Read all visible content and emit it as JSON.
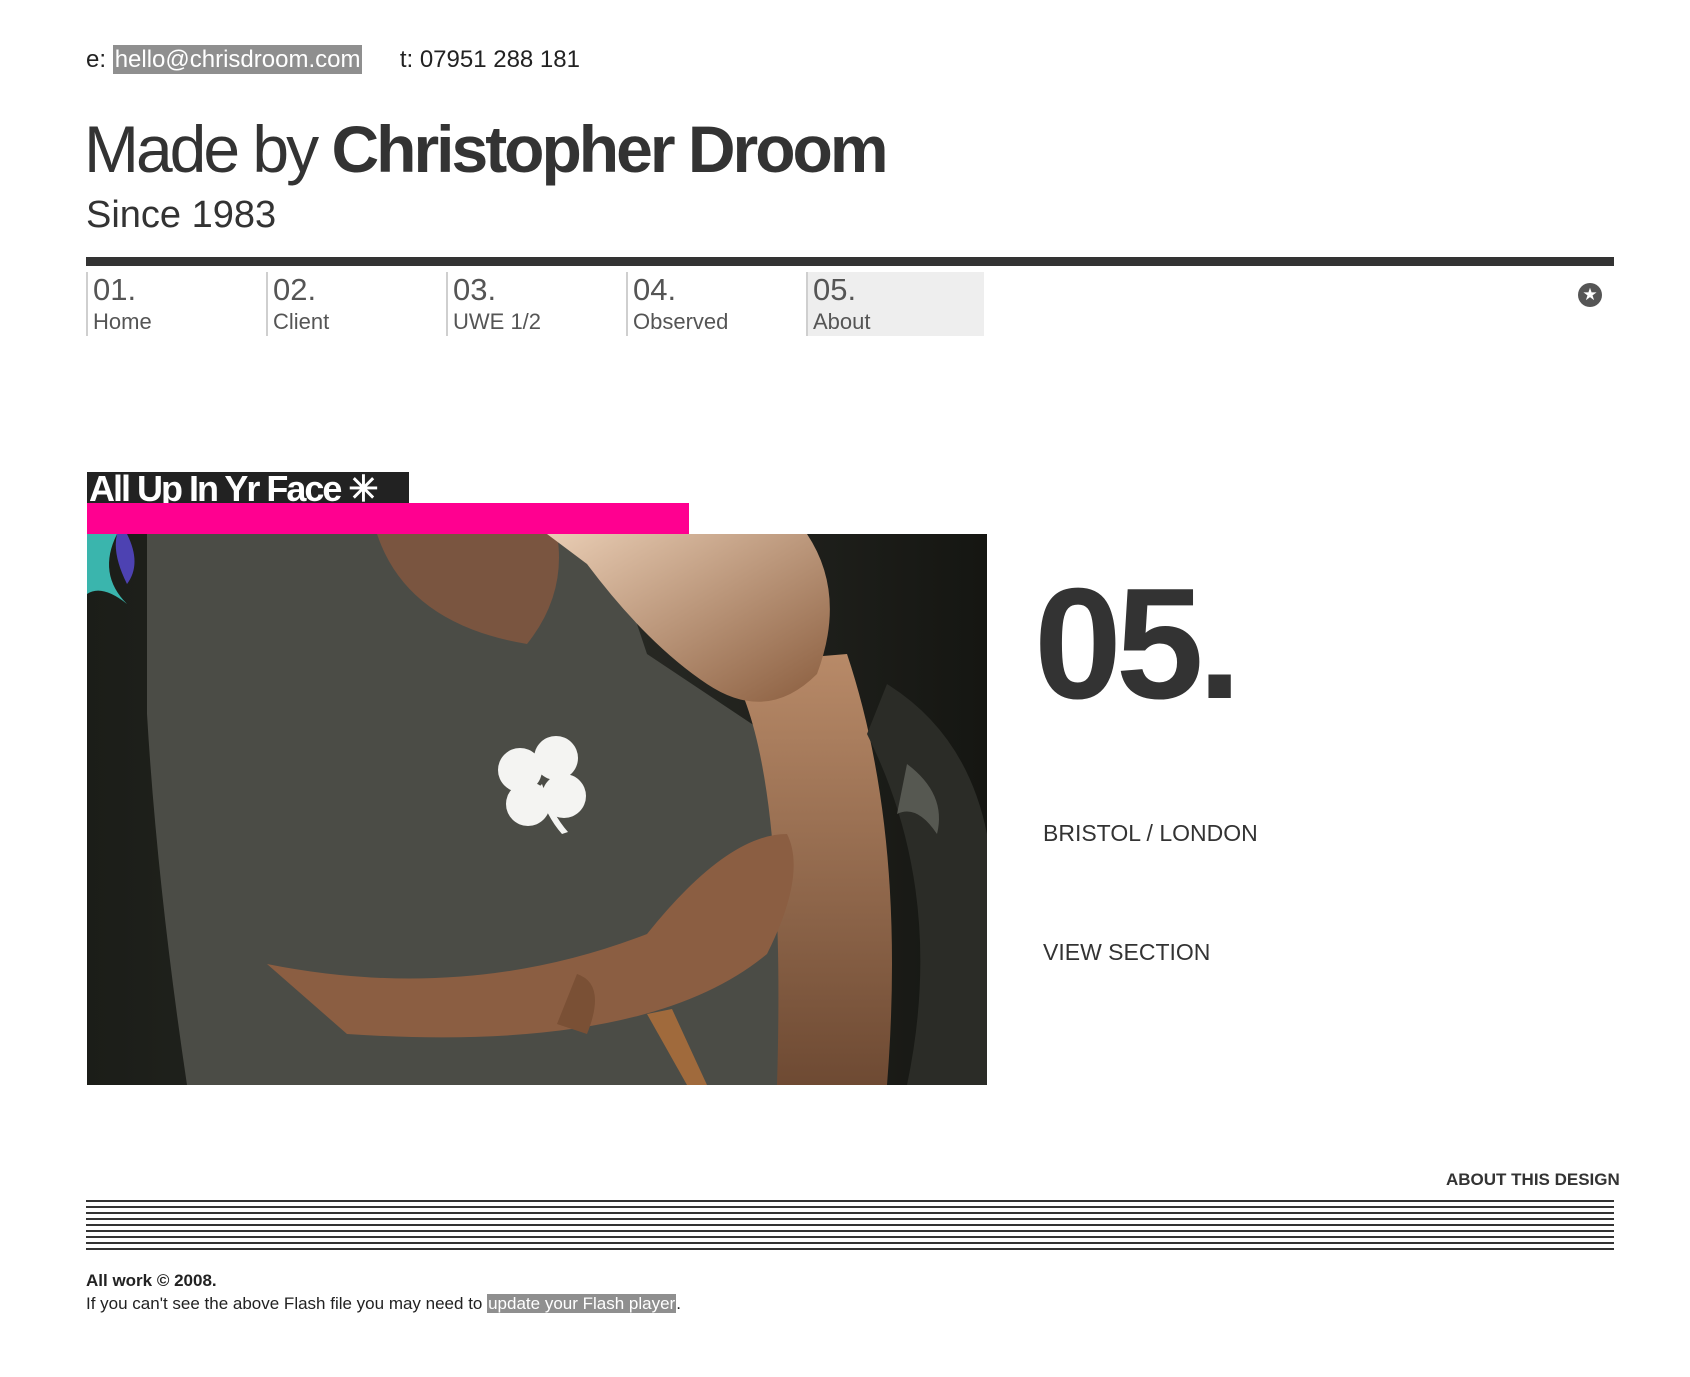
{
  "contact": {
    "email_prefix": "e:",
    "email": "hello@chrisdroom.com",
    "phone": "t: 07951 288 181"
  },
  "header": {
    "title_prefix": "Made by ",
    "title_name": "Christopher Droom",
    "subtitle": "Since 1983"
  },
  "nav": {
    "items": [
      {
        "num": "01.",
        "label": "Home"
      },
      {
        "num": "02.",
        "label": "Client"
      },
      {
        "num": "03.",
        "label": "UWE 1/2"
      },
      {
        "num": "04.",
        "label": "Observed"
      },
      {
        "num": "05.",
        "label": "About"
      }
    ],
    "active_index": 4,
    "star_icon": "star-circle-icon"
  },
  "feature": {
    "badge_text": "All Up In Yr Face ✳",
    "accent_color": "#ff0090",
    "section_number": "05.",
    "location": "BRISTOL / LONDON",
    "view_link": "VIEW SECTION"
  },
  "footer": {
    "about_design": "ABOUT THIS DESIGN",
    "copyright": "All work © 2008.",
    "flash_text": "If you can't see the above Flash file you may need to ",
    "flash_link": "update your Flash player",
    "flash_suffix": "."
  }
}
